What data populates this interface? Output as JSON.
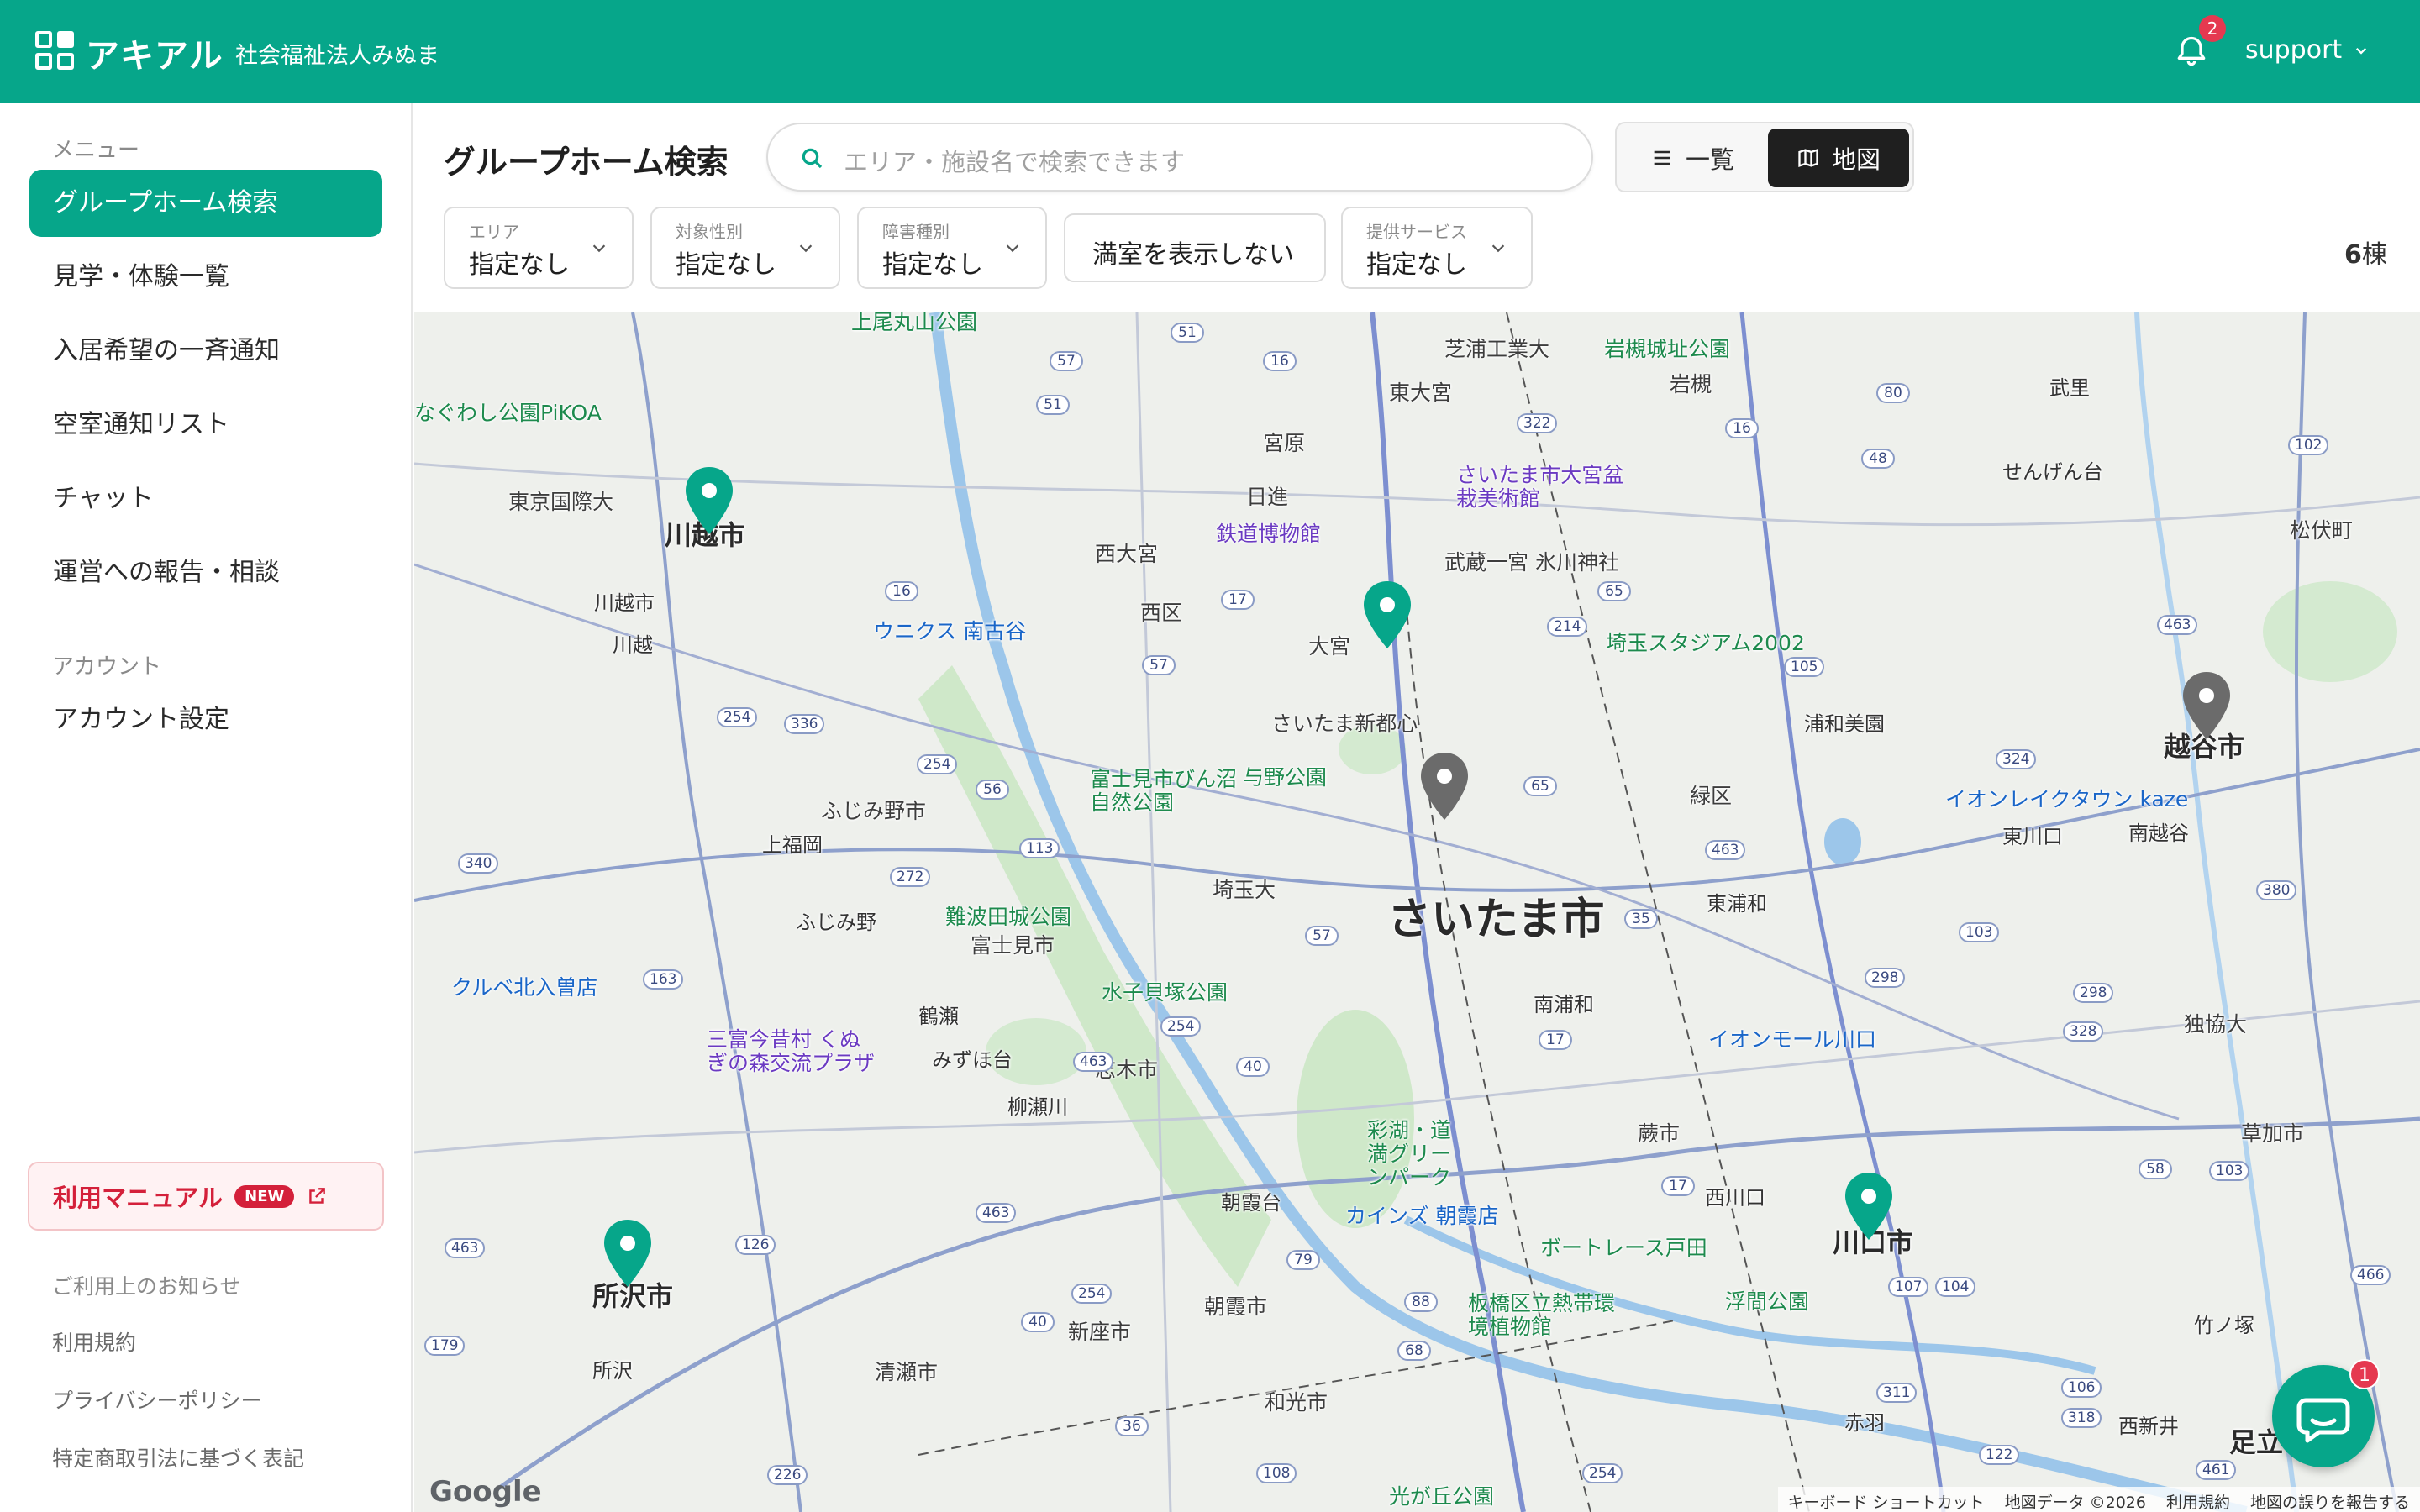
{
  "header": {
    "logo_text": "アキアル",
    "org_name": "社会福祉法人みぬま",
    "notification_count": "2",
    "user": "support"
  },
  "sidebar": {
    "menu_label": "メニュー",
    "menu_items": [
      {
        "label": "グループホーム検索",
        "active": true
      },
      {
        "label": "見学・体験一覧"
      },
      {
        "label": "入居希望の一斉通知"
      },
      {
        "label": "空室通知リスト"
      },
      {
        "label": "チャット"
      },
      {
        "label": "運営への報告・相談"
      }
    ],
    "account_label": "アカウント",
    "account_items": [
      {
        "label": "アカウント設定"
      }
    ],
    "manual": {
      "label": "利用マニュアル",
      "badge": "NEW"
    },
    "notice_label": "ご利用上のお知らせ",
    "footer_links": [
      "利用規約",
      "プライバシーポリシー",
      "特定商取引法に基づく表記"
    ]
  },
  "main": {
    "title": "グループホーム検索",
    "search_placeholder": "エリア・施設名で検索できます",
    "view_list_label": "一覧",
    "view_map_label": "地図",
    "filters": [
      {
        "caption": "エリア",
        "value": "指定なし"
      },
      {
        "caption": "対象性別",
        "value": "指定なし"
      },
      {
        "caption": "障害種別",
        "value": "指定なし"
      },
      {
        "caption": "",
        "value": "満室を表示しない"
      },
      {
        "caption": "提供サービス",
        "value": "指定なし"
      }
    ],
    "result_count": "6",
    "result_unit": "棟"
  },
  "map": {
    "labels": {
      "saitama": "さいたま市",
      "kawagoe": "川越市",
      "koshigaya": "越谷市",
      "tokorozawa": "所沢市",
      "kawaguchi": "川口市",
      "omiya": "大宮",
      "nishi_ku": "西区",
      "miyahara": "宮原",
      "nisshin": "日進",
      "nishi_omiya": "西大宮",
      "higashi_omiya": "東大宮",
      "iwatsuki": "岩槻",
      "shibaura": "芝浦工業大",
      "iwatsuki_park": "岩槻城址公園",
      "tetsudo": "鉄道博物館",
      "bonsai": "さいたま市大宮盆栽美術館",
      "hikawa": "武蔵一宮 氷川神社",
      "saitama_stadium": "埼玉スタジアム2002",
      "shintoshin": "さいたま新都心",
      "yono_park": "与野公園",
      "fujimino_park": "富士見市びん沼自然公園",
      "fujimino_city": "ふじみ野市",
      "kamifukuoka": "上福岡",
      "fujimino": "ふじみ野",
      "fujimi_city": "富士見市",
      "nanbata": "難波田城公園",
      "mizuko": "水子貝塚公園",
      "tsuruse": "鶴瀬",
      "mizuhodai": "みずほ台",
      "shiki": "志木市",
      "yanasegawa": "柳瀬川",
      "asakadai": "朝霞台",
      "asaka": "朝霞市",
      "niiza": "新座市",
      "kiyose": "清瀬市",
      "wako": "和光市",
      "saitama_univ": "埼玉大",
      "minamiurawa": "南浦和",
      "higashiurawa": "東浦和",
      "urawamisono": "浦和美園",
      "midori": "緑区",
      "warabi": "蕨市",
      "nishikawaguchi": "西川口",
      "aeon_kawaguchi": "イオンモール川口",
      "boatrace": "ボートレース戸田",
      "ukima": "浮間公園",
      "itabashi": "板橋区立熱帯環境植物館",
      "saiko_green": "彩湖・道満グリーンパーク",
      "cainz_asaka": "カインズ 朝霞店",
      "unix": "ウニクス 南古谷",
      "kawagoe_stn": "川越市",
      "kawagoe2": "川越",
      "tokyo_kokusai": "東京国際大",
      "kururu": "クルベ北入曽店",
      "santome": "三富今昔村 くぬぎの森交流プラザ",
      "tokorozawa_stn": "所沢",
      "sugaya": "東川口",
      "minamikoshigaya": "南越谷",
      "aeon_laketown": "イオンレイクタウン kaze",
      "soka": "草加市",
      "takenotsuka": "竹ノ塚",
      "nishiarai": "西新井",
      "adachi": "足立",
      "akabane": "赤羽",
      "takeri": "武里",
      "sengendai": "せんげん台",
      "matsubushi": "松伏町",
      "shimo_ichi": "独協大",
      "kamio": "上尾丸山公園",
      "nagowashi": "なぐわし公園PiKOA",
      "hikarigaoka": "光が丘公園",
      "google": "Google",
      "footer_keyboard": "キーボード ショートカット",
      "footer_data": "地図データ ©2026",
      "footer_terms": "利用規約",
      "footer_report": "地図の誤りを報告する"
    },
    "pins": [
      {
        "name": "kawagoe",
        "status": "available"
      },
      {
        "name": "omiya",
        "status": "available"
      },
      {
        "name": "saitama-center",
        "status": "full"
      },
      {
        "name": "koshigaya",
        "status": "full"
      },
      {
        "name": "tokorozawa",
        "status": "available"
      },
      {
        "name": "kawaguchi",
        "status": "available"
      }
    ]
  },
  "chat": {
    "unread": "1"
  },
  "colors": {
    "brand": "#06a68a",
    "alert": "#e53950",
    "pin_available": "#06a68a",
    "pin_full": "#6b6b6b"
  }
}
